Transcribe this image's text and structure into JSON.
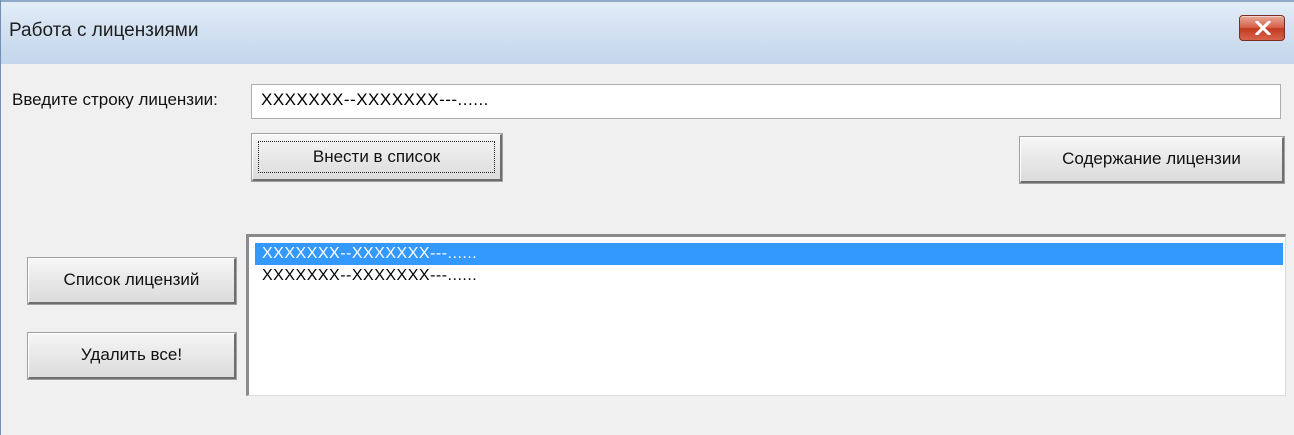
{
  "window": {
    "title": "Работа с лицензиями",
    "close_label": "close"
  },
  "form": {
    "license_label": "Введите строку лицензии:",
    "license_value": "XXXXXXX--XXXXXXX---......",
    "add_button": "Внести в список",
    "content_button": "Содержание лицензии",
    "list_button": "Список лицензий",
    "delete_all_button": "Удалить все!"
  },
  "license_list": {
    "items": [
      {
        "text": "XXXXXXX--XXXXXXX---......",
        "selected": true
      },
      {
        "text": "XXXXXXX--XXXXXXX---......",
        "selected": false
      }
    ]
  },
  "colors": {
    "selection": "#3399ff",
    "close_button": "#c23b22"
  },
  "icons": {
    "close": "close-icon"
  }
}
